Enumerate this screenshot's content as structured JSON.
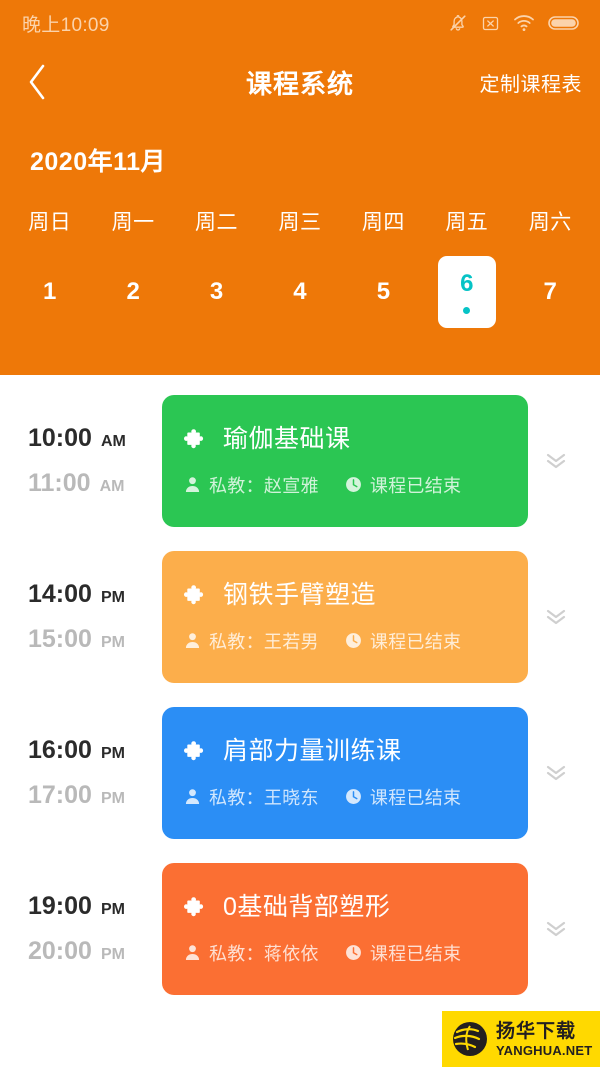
{
  "status_bar": {
    "time": "晚上10:09",
    "icons": [
      "bell-muted-icon",
      "x-box-icon",
      "wifi-icon",
      "battery-icon"
    ]
  },
  "header": {
    "back_icon": "chevron-left-icon",
    "title": "课程系统",
    "action_label": "定制课程表",
    "background_color": "#ee7808"
  },
  "calendar": {
    "month_label": "2020年11月",
    "weekdays": [
      "周日",
      "周一",
      "周二",
      "周三",
      "周四",
      "周五",
      "周六"
    ],
    "dates": [
      {
        "day": "1",
        "selected": false
      },
      {
        "day": "2",
        "selected": false
      },
      {
        "day": "3",
        "selected": false
      },
      {
        "day": "4",
        "selected": false
      },
      {
        "day": "5",
        "selected": false
      },
      {
        "day": "6",
        "selected": true
      },
      {
        "day": "7",
        "selected": false
      }
    ],
    "selected_color": "#06c3c6"
  },
  "schedule": {
    "expand_icon": "chevrons-down-icon",
    "coach_icon": "person-icon",
    "status_icon": "clock-icon",
    "card_icon": "puzzle-piece-icon",
    "classes": [
      {
        "start_time": "10:00",
        "start_meridiem": "AM",
        "end_time": "11:00",
        "end_meridiem": "AM",
        "title": "瑜伽基础课",
        "coach": "私教：赵宣雅",
        "status": "课程已结束",
        "color": "#2bc653"
      },
      {
        "start_time": "14:00",
        "start_meridiem": "PM",
        "end_time": "15:00",
        "end_meridiem": "PM",
        "title": "钢铁手臂塑造",
        "coach": "私教：王若男",
        "status": "课程已结束",
        "color": "#fcae4b"
      },
      {
        "start_time": "16:00",
        "start_meridiem": "PM",
        "end_time": "17:00",
        "end_meridiem": "PM",
        "title": "肩部力量训练课",
        "coach": "私教：王晓东",
        "status": "课程已结束",
        "color": "#2b8ef5"
      },
      {
        "start_time": "19:00",
        "start_meridiem": "PM",
        "end_time": "20:00",
        "end_meridiem": "PM",
        "title": "0基础背部塑形",
        "coach": "私教：蒋依依",
        "status": "课程已结束",
        "color": "#fb6f33"
      }
    ]
  },
  "watermark": {
    "cn_text": "扬华下载",
    "en_text": "YANGHUA.NET",
    "background_color": "#ffd900"
  }
}
